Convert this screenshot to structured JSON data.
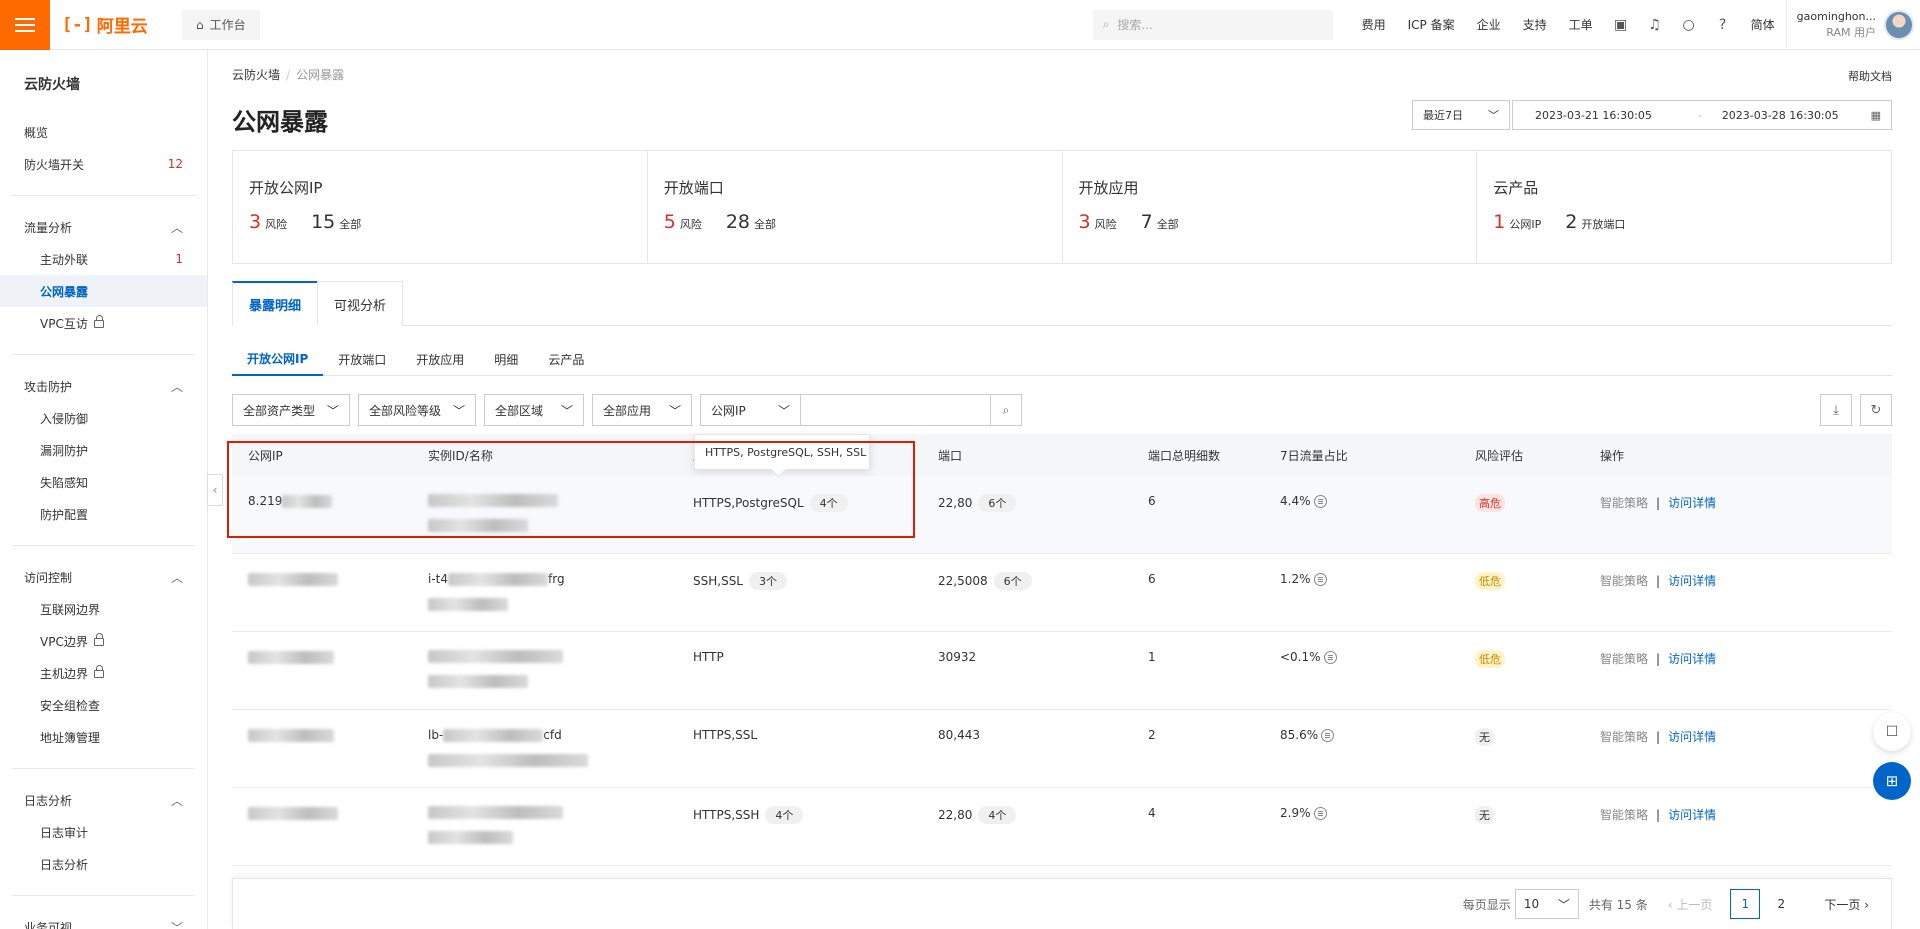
{
  "topbar": {
    "brand": "阿里云",
    "workbench": "工作台",
    "search_placeholder": "搜索...",
    "links": [
      "费用",
      "ICP 备案",
      "企业",
      "支持",
      "工单"
    ],
    "lang": "简体",
    "user_name": "gaominghon...",
    "user_role": "RAM 用户"
  },
  "sidebar": {
    "title": "云防火墙",
    "overview": "概览",
    "firewall_switch": "防火墙开关",
    "firewall_switch_count": "12",
    "traffic_group": "流量分析",
    "outbound": "主动外联",
    "outbound_count": "1",
    "exposure": "公网暴露",
    "vpc_mutual": "VPC互访",
    "attack_group": "攻击防护",
    "intrusion": "入侵防御",
    "vuln": "漏洞防护",
    "breach": "失陷感知",
    "protect_config": "防护配置",
    "access_group": "访问控制",
    "internet_border": "互联网边界",
    "vpc_border": "VPC边界",
    "host_border": "主机边界",
    "sg_check": "安全组检查",
    "address_book": "地址簿管理",
    "log_group": "日志分析",
    "log_audit": "日志审计",
    "log_analysis": "日志分析",
    "business_group": "业务可视"
  },
  "header": {
    "breadcrumb_root": "云防火墙",
    "breadcrumb_current": "公网暴露",
    "help": "帮助文档",
    "title": "公网暴露",
    "date_preset": "最近7日",
    "date_start": "2023-03-21 16:30:05",
    "date_end": "2023-03-28 16:30:05"
  },
  "stats": [
    {
      "title": "开放公网IP",
      "v1": "3",
      "u1": "风险",
      "v2": "15",
      "u2": "全部"
    },
    {
      "title": "开放端口",
      "v1": "5",
      "u1": "风险",
      "v2": "28",
      "u2": "全部"
    },
    {
      "title": "开放应用",
      "v1": "3",
      "u1": "风险",
      "v2": "7",
      "u2": "全部"
    },
    {
      "title": "云产品",
      "v1": "1",
      "u1": "公网IP",
      "v2": "2",
      "u2": "开放端口"
    }
  ],
  "tabs_main": [
    "暴露明细",
    "可视分析"
  ],
  "tabs_sub": [
    "开放公网IP",
    "开放端口",
    "开放应用",
    "明细",
    "云产品"
  ],
  "filters": {
    "asset_type": "全部资产类型",
    "risk_level": "全部风险等级",
    "region": "全部区域",
    "app": "全部应用",
    "search_field": "公网IP"
  },
  "table": {
    "headers": [
      "公网IP",
      "实例ID/名称",
      "应用",
      "端口",
      "端口总明细数",
      "7日流量占比",
      "风险评估",
      "操作"
    ],
    "tooltip": "HTTPS, PostgreSQL, SSH, SSL",
    "rows": [
      {
        "ip": "8.219",
        "id": "",
        "app": "HTTPS,PostgreSQL",
        "app_count": "4个",
        "port": "22,80",
        "port_count": "6个",
        "detail": "6",
        "traffic": "4.4%",
        "risk": "高危"
      },
      {
        "ip": "",
        "id": "i-t4",
        "id_tail": "frg",
        "app": "SSH,SSL",
        "app_count": "3个",
        "port": "22,5008",
        "port_count": "6个",
        "detail": "6",
        "traffic": "1.2%",
        "risk": "低危"
      },
      {
        "ip": "",
        "id": "",
        "app": "HTTP",
        "app_count": "",
        "port": "30932",
        "port_count": "",
        "detail": "1",
        "traffic": "<0.1%",
        "risk": "低危"
      },
      {
        "ip": "",
        "id": "lb-",
        "id_tail": "cfd",
        "app": "HTTPS,SSL",
        "app_count": "",
        "port": "80,443",
        "port_count": "",
        "detail": "2",
        "traffic": "85.6%",
        "risk": "无"
      },
      {
        "ip": "",
        "id": "",
        "app": "HTTPS,SSH",
        "app_count": "4个",
        "port": "22,80",
        "port_count": "4个",
        "detail": "4",
        "traffic": "2.9%",
        "risk": "无"
      }
    ],
    "op_policy": "智能策略",
    "op_detail": "访问详情"
  },
  "pager": {
    "page_size_label": "每页显示",
    "page_size": "10",
    "total": "共有 15 条",
    "prev": "上一页",
    "pages": [
      "1",
      "2"
    ],
    "next": "下一页"
  }
}
